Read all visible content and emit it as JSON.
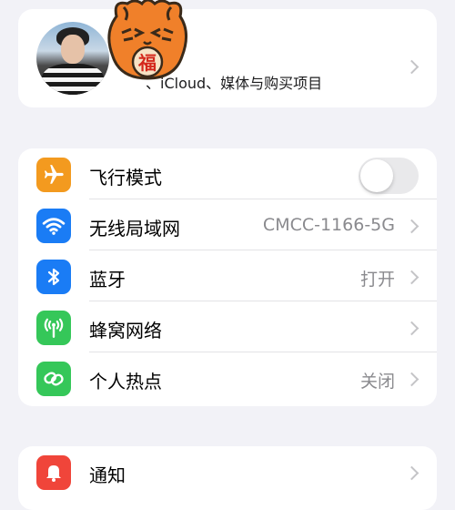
{
  "profile": {
    "subtitle_prefix": "、",
    "subtitle": "iCloud、媒体与购买项目",
    "sticker_text": "福"
  },
  "network": {
    "airplane": {
      "label": "飞行模式",
      "toggle_on": false,
      "icon": "airplane-icon",
      "color": "#f39a1f"
    },
    "wifi": {
      "label": "无线局域网",
      "value": "CMCC-1166-5G",
      "icon": "wifi-icon",
      "color": "#1a7cf5"
    },
    "bluetooth": {
      "label": "蓝牙",
      "value": "打开",
      "icon": "bluetooth-icon",
      "color": "#1a7cf5"
    },
    "cellular": {
      "label": "蜂窝网络",
      "icon": "cellular-antenna-icon",
      "color": "#35c759"
    },
    "hotspot": {
      "label": "个人热点",
      "value": "关闭",
      "icon": "hotspot-icon",
      "color": "#35c759"
    }
  },
  "notifications": {
    "label": "通知",
    "icon": "bell-icon",
    "color": "#f0453a"
  }
}
